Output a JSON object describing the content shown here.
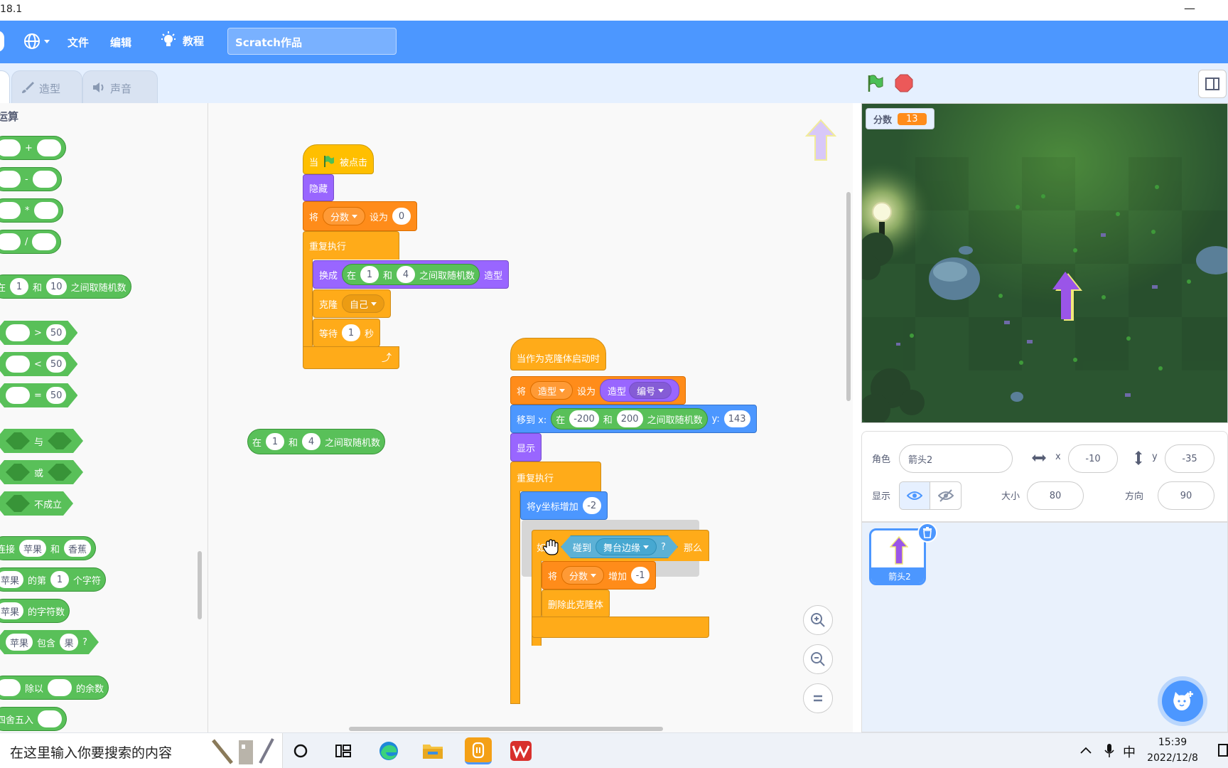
{
  "titlebar": {
    "version": "18.1",
    "minimize": "—",
    "close": "✕"
  },
  "menubar": {
    "file": "文件",
    "edit": "编辑",
    "tutorial": "教程",
    "project_title": "Scratch作品"
  },
  "tabs": {
    "costumes": "造型",
    "sounds": "声音"
  },
  "palette": {
    "category": "运算",
    "add": "+",
    "sub": "-",
    "mul": "*",
    "div": "/",
    "rand": {
      "pre": "在",
      "a": "1",
      "mid": "和",
      "b": "10",
      "post": "之间取随机数"
    },
    "gt": {
      "op": ">",
      "v": "50"
    },
    "lt": {
      "op": "<",
      "v": "50"
    },
    "eq": {
      "op": "=",
      "v": "50"
    },
    "and": "与",
    "or": "或",
    "not": "不成立",
    "join": {
      "pre": "连接",
      "a": "苹果",
      "mid": "和",
      "b": "香蕉"
    },
    "letter": {
      "a": "苹果",
      "mid": "的第",
      "n": "1",
      "post": "个字符"
    },
    "length": {
      "a": "苹果",
      "post": "的字符数"
    },
    "contains": {
      "a": "苹果",
      "mid": "包含",
      "b": "果",
      "q": "?"
    },
    "mod": {
      "mid": "除以",
      "post": "的余数"
    },
    "round": "四舍五入"
  },
  "script1": {
    "hat": {
      "pre": "当",
      "post": "被点击"
    },
    "hide": "隐藏",
    "setvar": {
      "pre": "将",
      "var": "分数",
      "mid": "设为",
      "val": "0"
    },
    "forever": "重复执行",
    "switch": {
      "pre": "换成",
      "rpre": "在",
      "a": "1",
      "rmid": "和",
      "b": "4",
      "rpost": "之间取随机数",
      "post": "造型"
    },
    "clone": {
      "pre": "克隆",
      "target": "自己"
    },
    "wait": {
      "pre": "等待",
      "val": "1",
      "post": "秒"
    },
    "loop_arrow": "⤴"
  },
  "loose": {
    "pre": "在",
    "a": "1",
    "mid": "和",
    "b": "4",
    "post": "之间取随机数"
  },
  "script2": {
    "hat": "当作为克隆体启动时",
    "setcostume": {
      "pre": "将",
      "var": "造型",
      "mid": "设为",
      "rep": "造型",
      "prop": "编号"
    },
    "goto": {
      "pre": "移到 x:",
      "rpre": "在",
      "a": "-200",
      "rmid": "和",
      "b": "200",
      "rpost": "之间取随机数",
      "ylabel": "y:",
      "y": "143"
    },
    "show": "显示",
    "forever": "重复执行",
    "changey": {
      "pre": "将y坐标增加",
      "val": "-2"
    },
    "if": {
      "pre": "如果",
      "sense": "碰到",
      "edge": "舞台边缘",
      "q": "?",
      "then": "那么"
    },
    "changevar": {
      "pre": "将",
      "var": "分数",
      "mid": "增加",
      "val": "-1"
    },
    "delete": "删除此克隆体"
  },
  "stage": {
    "monitor_label": "分数",
    "monitor_value": "13"
  },
  "sprite_info": {
    "sprite_label": "角色",
    "sprite_name": "箭头2",
    "x_label": "x",
    "x": "-10",
    "y_label": "y",
    "y": "-35",
    "show_label": "显示",
    "size_label": "大小",
    "size": "80",
    "direction_label": "方向",
    "direction": "90"
  },
  "sprite_list": [
    {
      "name": "箭头2"
    }
  ],
  "taskbar": {
    "search_placeholder": "在这里输入你要搜索的内容",
    "time": "15:39",
    "date": "2022/12/8",
    "ime": "中"
  }
}
